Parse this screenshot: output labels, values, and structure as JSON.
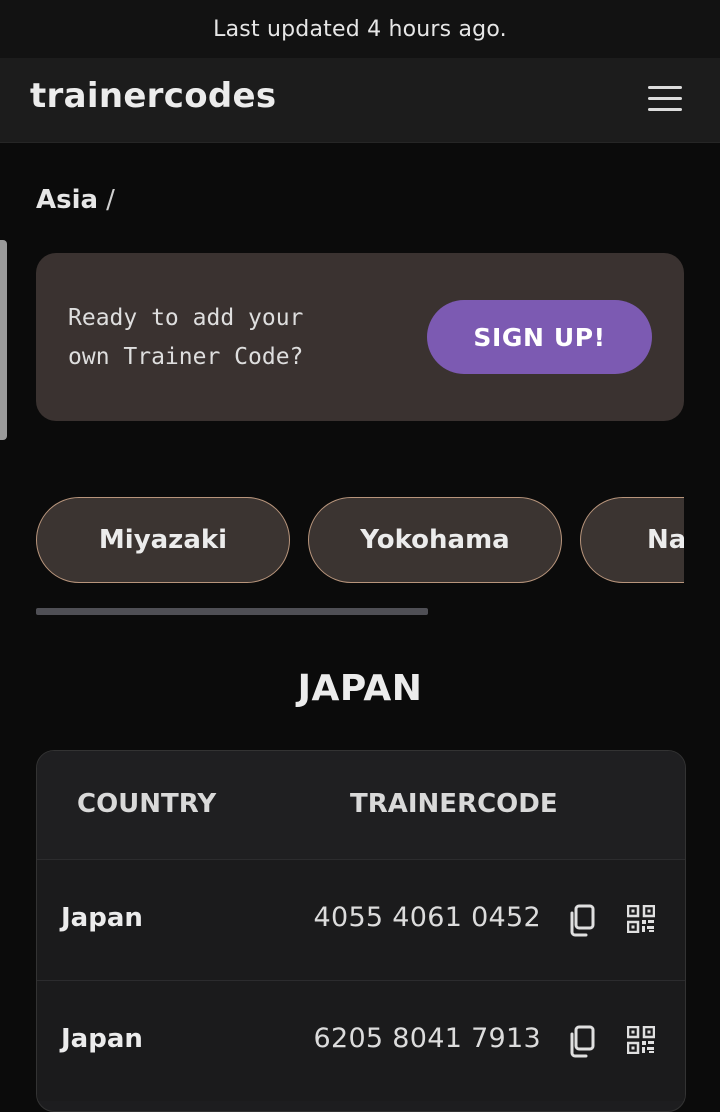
{
  "banner": {
    "text": "Last updated 4 hours ago."
  },
  "header": {
    "brand": "trainercodes",
    "menu_icon": "hamburger-menu-icon"
  },
  "breadcrumb": {
    "region": "Asia",
    "separator": "/"
  },
  "signup": {
    "prompt": "Ready to add your\nown Trainer Code?",
    "button_label": "SIGN UP!"
  },
  "cities": [
    "Miyazaki",
    "Yokohama",
    "Na"
  ],
  "section": {
    "title": "JAPAN"
  },
  "table": {
    "headers": {
      "country": "COUNTRY",
      "code": "TRAINERCODE"
    },
    "rows": [
      {
        "country": "Japan",
        "code": "4055 4061 0452"
      },
      {
        "country": "Japan",
        "code": "6205 8041 7913"
      }
    ],
    "icons": {
      "copy": "copy-icon",
      "qr": "qr-code-icon"
    }
  },
  "colors": {
    "accent": "#7c5ab2",
    "chip_border": "#b8957c",
    "card_bg": "#3a3230"
  }
}
